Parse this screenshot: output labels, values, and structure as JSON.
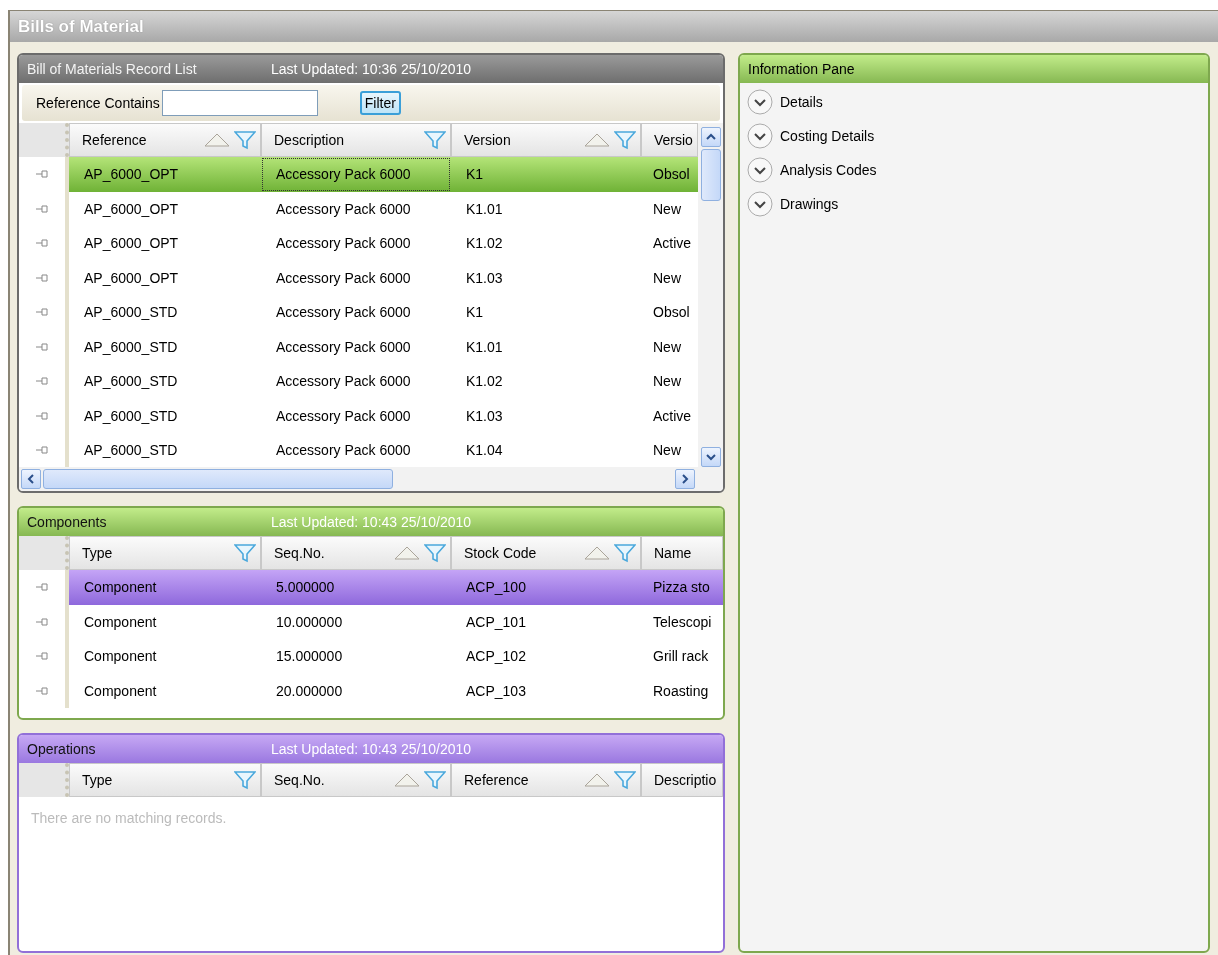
{
  "window": {
    "title": "Bills of Material"
  },
  "record_list": {
    "title": "Bill of Materials Record List",
    "updated": "Last Updated: 10:36 25/10/2010",
    "filter_label": "Reference Contains",
    "filter_button": "Filter",
    "columns": [
      {
        "label": "Reference",
        "sortable": true,
        "filter": true
      },
      {
        "label": "Description",
        "sortable": false,
        "filter": true
      },
      {
        "label": "Version",
        "sortable": true,
        "filter": true
      },
      {
        "label": "Versio",
        "sortable": false,
        "filter": false
      }
    ],
    "rows": [
      {
        "selected": true,
        "cells": [
          "AP_6000_OPT",
          "Accessory Pack 6000",
          "K1",
          "Obsol"
        ]
      },
      {
        "selected": false,
        "cells": [
          "AP_6000_OPT",
          "Accessory Pack 6000",
          "K1.01",
          "New"
        ]
      },
      {
        "selected": false,
        "cells": [
          "AP_6000_OPT",
          "Accessory Pack 6000",
          "K1.02",
          "Active"
        ]
      },
      {
        "selected": false,
        "cells": [
          "AP_6000_OPT",
          "Accessory Pack 6000",
          "K1.03",
          "New"
        ]
      },
      {
        "selected": false,
        "cells": [
          "AP_6000_STD",
          "Accessory Pack 6000",
          "K1",
          "Obsol"
        ]
      },
      {
        "selected": false,
        "cells": [
          "AP_6000_STD",
          "Accessory Pack 6000",
          "K1.01",
          "New"
        ]
      },
      {
        "selected": false,
        "cells": [
          "AP_6000_STD",
          "Accessory Pack 6000",
          "K1.02",
          "New"
        ]
      },
      {
        "selected": false,
        "cells": [
          "AP_6000_STD",
          "Accessory Pack 6000",
          "K1.03",
          "Active"
        ]
      },
      {
        "selected": false,
        "cells": [
          "AP_6000_STD",
          "Accessory Pack 6000",
          "K1.04",
          "New"
        ]
      }
    ]
  },
  "components": {
    "title": "Components",
    "updated": "Last Updated: 10:43 25/10/2010",
    "columns": [
      {
        "label": "Type",
        "sortable": false,
        "filter": true
      },
      {
        "label": "Seq.No.",
        "sortable": true,
        "filter": true
      },
      {
        "label": "Stock Code",
        "sortable": true,
        "filter": true
      },
      {
        "label": "Name",
        "sortable": false,
        "filter": false
      }
    ],
    "rows": [
      {
        "selected": true,
        "cells": [
          "Component",
          "5.000000",
          "ACP_100",
          "Pizza sto"
        ]
      },
      {
        "selected": false,
        "cells": [
          "Component",
          "10.000000",
          "ACP_101",
          "Telescopi"
        ]
      },
      {
        "selected": false,
        "cells": [
          "Component",
          "15.000000",
          "ACP_102",
          "Grill rack"
        ]
      },
      {
        "selected": false,
        "cells": [
          "Component",
          "20.000000",
          "ACP_103",
          "Roasting"
        ]
      }
    ]
  },
  "operations": {
    "title": "Operations",
    "updated": "Last Updated: 10:43 25/10/2010",
    "columns": [
      {
        "label": "Type",
        "sortable": false,
        "filter": true
      },
      {
        "label": "Seq.No.",
        "sortable": true,
        "filter": true
      },
      {
        "label": "Reference",
        "sortable": true,
        "filter": true
      },
      {
        "label": "Descriptio",
        "sortable": false,
        "filter": false
      }
    ],
    "empty_message": "There are no matching records."
  },
  "information_pane": {
    "title": "Information Pane",
    "sections": [
      {
        "label": "Details",
        "expanded": false
      },
      {
        "label": "Costing Details",
        "expanded": false
      },
      {
        "label": "Analysis Codes",
        "expanded": false
      },
      {
        "label": "Drawings",
        "expanded": false
      }
    ]
  }
}
